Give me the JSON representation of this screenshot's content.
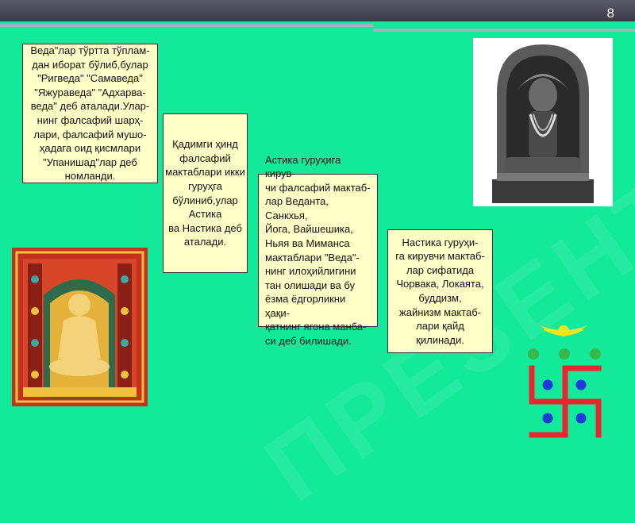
{
  "slide": {
    "number": "8"
  },
  "boxes": {
    "vedas": "Веда\"лар тўртта тўплам-\nдан иборат бўлиб,булар\n\"Ригведа\" \"Самаведа\"\n\"Яжураведа\" \"Адхарва-\nведа\" деб аталади.Улар-\nнинг фалсафий шарҳ-\nлари, фалсафий мушо-\nҳадага оид қисмлари\n\"Упанишад\"лар деб\nномланди.",
    "schools": "Қадимги ҳинд\nфалсафий\nмактаблари икки\nгуруҳга\nбўлиниб,улар\nАстика\nва Настика деб\nаталади.",
    "astika": "Астика гуруҳига кирув-\nчи фалсафий мактаб-\nлар Веданта, Санкхья,\n Йога, Вайшешика,\nНьяя ва Миманса\nмактаблари \"Веда\"-\nнинг илоҳийлигини\nтан олишади ва бу\nёзма ёдгорликни ҳақи-\nқатнинг ягона манба-\nси деб билишади.",
    "nastika": "Настика гуруҳи-\nга кирувчи мактаб-\nлар сифатида\nЧорвака, Локаята,\nбуддизм,\nжайнизм мактаб-\nлари қайд\nқилинади."
  },
  "colors": {
    "background": "#12ea9a",
    "box_fill": "#ffffc8",
    "symbol_red": "#e8262e",
    "symbol_blue": "#1e3ad8",
    "symbol_green": "#36b84a",
    "symbol_yellow": "#f2e51c"
  }
}
